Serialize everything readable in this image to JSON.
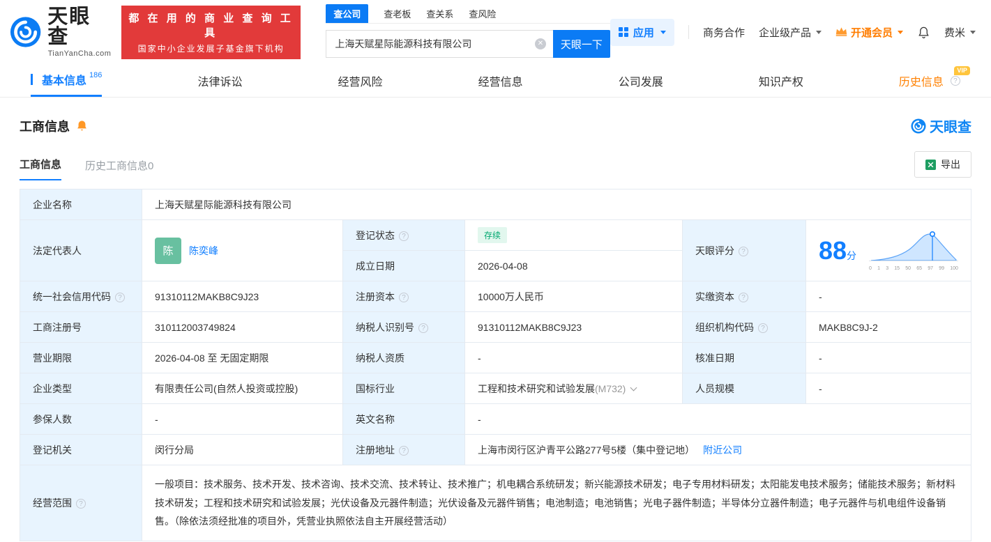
{
  "colors": {
    "brand_blue": "#127fff",
    "accent_red": "#e23a3a",
    "vip_orange": "#ff7d00",
    "status_green": "#00a870",
    "label_bg": "#e8f4fe"
  },
  "brand": {
    "name": "天眼查",
    "domain": "TianYanCha.com"
  },
  "header": {
    "slogan_line1": "都 在 用 的 商 业 查 询 工 具",
    "slogan_line2": "国家中小企业发展子基金旗下机构",
    "search_tabs": [
      {
        "label": "查公司"
      },
      {
        "label": "查老板"
      },
      {
        "label": "查关系"
      },
      {
        "label": "查风险"
      }
    ],
    "search_value": "上海天赋星际能源科技有限公司",
    "search_button": "天眼一下",
    "menu_apps": "应用",
    "menu_cooperation": "商务合作",
    "menu_enterprise": "企业级产品",
    "menu_vip": "开通会员",
    "menu_user": "费米"
  },
  "nav": {
    "tabs": [
      {
        "label": "基本信息",
        "count": "186"
      },
      {
        "label": "法律诉讼"
      },
      {
        "label": "经营风险"
      },
      {
        "label": "经营信息"
      },
      {
        "label": "公司发展"
      },
      {
        "label": "知识产权"
      },
      {
        "label": "历史信息",
        "vip": "VIP"
      }
    ]
  },
  "section": {
    "title": "工商信息",
    "logo": "天眼查",
    "tabs": [
      {
        "label": "工商信息"
      },
      {
        "label": "历史工商信息0"
      }
    ],
    "export": "导出"
  },
  "company": {
    "name_label": "企业名称",
    "name": "上海天赋星际能源科技有限公司",
    "legal_rep_label": "法定代表人",
    "legal_rep_avatar": "陈",
    "legal_rep": "陈奕峰",
    "reg_status_label": "登记状态",
    "reg_status": "存续",
    "establish_date_label": "成立日期",
    "establish_date": "2026-04-08",
    "score_label": "天眼评分",
    "score": "88",
    "score_unit": "分",
    "score_axis": [
      "0",
      "1",
      "3",
      "15",
      "50",
      "65",
      "97",
      "99",
      "100"
    ],
    "credit_code_label": "统一社会信用代码",
    "credit_code": "91310112MAKB8C9J23",
    "reg_capital_label": "注册资本",
    "reg_capital": "10000万人民币",
    "paid_capital_label": "实缴资本",
    "paid_capital": "-",
    "reg_number_label": "工商注册号",
    "reg_number": "310112003749824",
    "taxpayer_id_label": "纳税人识别号",
    "taxpayer_id": "91310112MAKB8C9J23",
    "org_code_label": "组织机构代码",
    "org_code": "MAKB8C9J-2",
    "business_term_label": "营业期限",
    "business_term": "2026-04-08 至 无固定期限",
    "taxpayer_quality_label": "纳税人资质",
    "taxpayer_quality": "-",
    "approval_date_label": "核准日期",
    "approval_date": "-",
    "company_type_label": "企业类型",
    "company_type": "有限责任公司(自然人投资或控股)",
    "industry_label": "国标行业",
    "industry": "工程和技术研究和试验发展",
    "industry_code": "(M732)",
    "staff_size_label": "人员规模",
    "staff_size": "-",
    "insured_label": "参保人数",
    "insured": "-",
    "english_name_label": "英文名称",
    "english_name": "-",
    "reg_authority_label": "登记机关",
    "reg_authority": "闵行分局",
    "address_label": "注册地址",
    "address": "上海市闵行区沪青平公路277号5楼（集中登记地）",
    "address_link": "附近公司",
    "business_scope_label": "经营范围",
    "business_scope": "一般项目：技术服务、技术开发、技术咨询、技术交流、技术转让、技术推广；机电耦合系统研发；新兴能源技术研发；电子专用材料研发；太阳能发电技术服务；储能技术服务；新材料技术研发；工程和技术研究和试验发展；光伏设备及元器件制造；光伏设备及元器件销售；电池制造；电池销售；光电子器件制造；半导体分立器件制造；电子元器件与机电组件设备销售。（除依法须经批准的项目外，凭营业执照依法自主开展经营活动）"
  }
}
